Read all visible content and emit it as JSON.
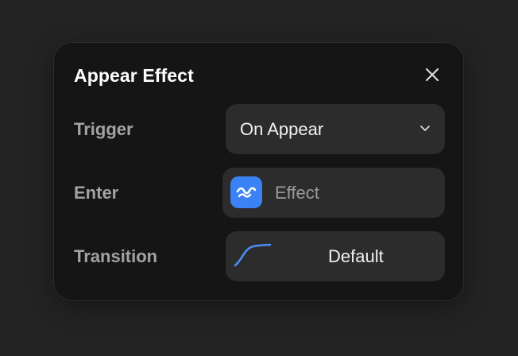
{
  "panel": {
    "title": "Appear Effect",
    "close_icon": "close-icon"
  },
  "rows": {
    "trigger": {
      "label": "Trigger",
      "value": "On Appear",
      "icon": "chevron-down-icon"
    },
    "enter": {
      "label": "Enter",
      "value": "Effect",
      "icon": "wave-icon"
    },
    "transition": {
      "label": "Transition",
      "value": "Default",
      "icon": "easing-curve-icon"
    }
  },
  "colors": {
    "background": "#232323",
    "panel": "#151515",
    "control": "#2c2c2c",
    "accent": "#3b82f6",
    "label": "#a3a3a3",
    "text": "#f2f2f2"
  }
}
